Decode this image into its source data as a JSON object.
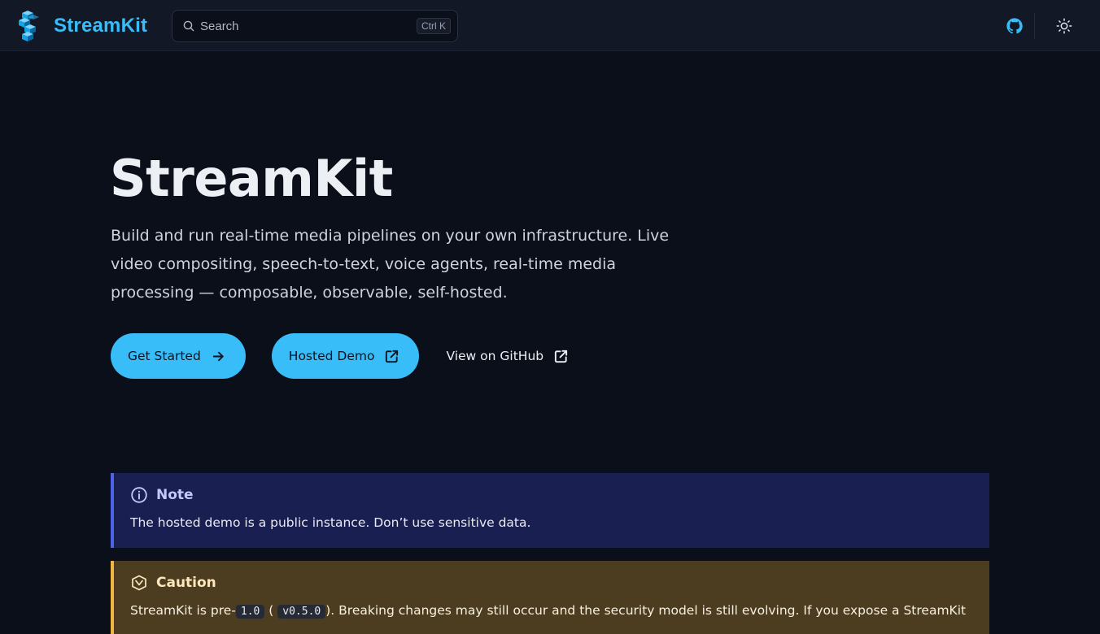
{
  "header": {
    "brand_name": "StreamKit",
    "search_placeholder": "Search",
    "search_shortcut": "Ctrl K",
    "github_label": "GitHub",
    "theme_label": "Toggle theme"
  },
  "hero": {
    "title": "StreamKit",
    "description": "Build and run real-time media pipelines on your own infrastructure. Live video compositing, speech-to-text, voice agents, real-time media processing — composable, observable, self-hosted.",
    "actions": [
      {
        "label": "Get Started",
        "icon": "arrow-right-icon"
      },
      {
        "label": "Hosted Demo",
        "icon": "external-link-icon"
      },
      {
        "label": "View on GitHub",
        "icon": "external-link-icon"
      }
    ]
  },
  "asides": {
    "note": {
      "title": "Note",
      "body": "The hosted demo is a public instance. Don’t use sensitive data.",
      "icon": "info-icon"
    },
    "caution": {
      "title": "Caution",
      "body_prefix": "StreamKit is pre-",
      "code_version": "1.0",
      "body_open_paren": " (",
      "code_release": "v0.5.0",
      "body_suffix": "). Breaking changes may still occur and the security model is still evolving. If you expose a StreamKit",
      "icon": "warning-icon"
    }
  },
  "colors": {
    "accent": "#38bdf8",
    "page_bg": "#0b0f19",
    "header_bg": "#121826",
    "note_bg": "#1a1f52",
    "note_border": "#4f63e6",
    "caution_bg": "#4d3d20",
    "caution_border": "#f0b542"
  }
}
